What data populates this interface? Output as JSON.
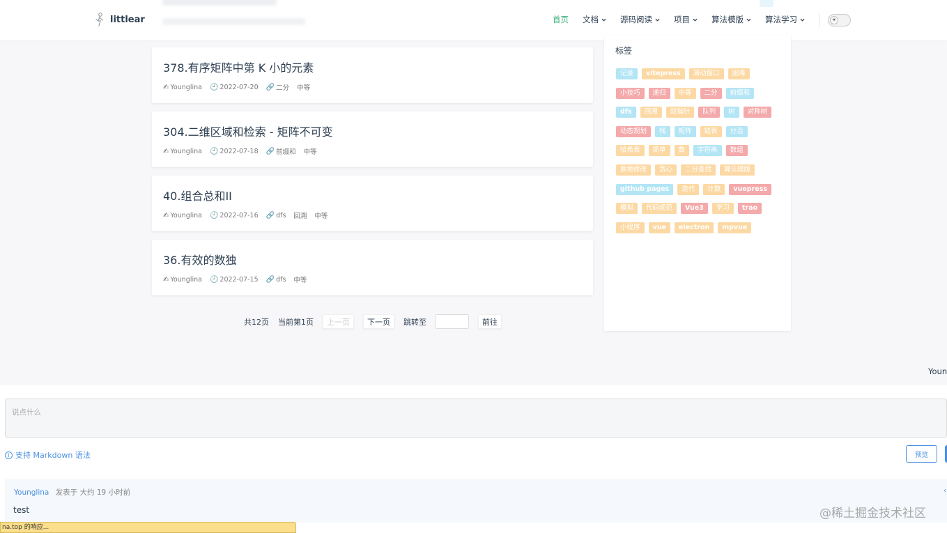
{
  "navbar": {
    "brand": "littlear",
    "items": [
      {
        "label": "首页",
        "active": true,
        "dropdown": false
      },
      {
        "label": "文档",
        "active": false,
        "dropdown": true
      },
      {
        "label": "源码阅读",
        "active": false,
        "dropdown": true
      },
      {
        "label": "项目",
        "active": false,
        "dropdown": true
      },
      {
        "label": "算法模版",
        "active": false,
        "dropdown": true
      },
      {
        "label": "算法学习",
        "active": false,
        "dropdown": true
      }
    ],
    "theme_icon": "☀"
  },
  "articles": [
    {
      "title": "378.有序矩阵中第 K 小的元素",
      "author": "Younglina",
      "date": "2022-07-20",
      "tags": [
        "二分"
      ],
      "difficulty": "中等"
    },
    {
      "title": "304.二维区域和检索 - 矩阵不可变",
      "author": "Younglina",
      "date": "2022-07-18",
      "tags": [
        "前缀和"
      ],
      "difficulty": "中等"
    },
    {
      "title": "40.组合总和II",
      "author": "Younglina",
      "date": "2022-07-16",
      "tags": [
        "dfs",
        "回溯"
      ],
      "difficulty": "中等"
    },
    {
      "title": "36.有效的数独",
      "author": "Younglina",
      "date": "2022-07-15",
      "tags": [
        "dfs"
      ],
      "difficulty": "中等"
    }
  ],
  "meta_icons": {
    "author": "✍",
    "date": "🕘",
    "tag": "🔗"
  },
  "pagination": {
    "total": "共12页",
    "current": "当前第1页",
    "prev": "上一页",
    "next": "下一页",
    "jump_label": "跳转至",
    "go": "前往"
  },
  "tags_panel": {
    "title": "标签",
    "tags": [
      {
        "label": "记录",
        "color": "blue"
      },
      {
        "label": "vitepress",
        "color": "orange",
        "bold": true
      },
      {
        "label": "滑动窗口",
        "color": "orange"
      },
      {
        "label": "困难",
        "color": "orange"
      },
      {
        "label": "小技巧",
        "color": "red"
      },
      {
        "label": "递归",
        "color": "red"
      },
      {
        "label": "中等",
        "color": "orange"
      },
      {
        "label": "二分",
        "color": "red"
      },
      {
        "label": "前缀和",
        "color": "blue"
      },
      {
        "label": "dfs",
        "color": "blue",
        "bold": true
      },
      {
        "label": "回溯",
        "color": "orange"
      },
      {
        "label": "双指针",
        "color": "orange"
      },
      {
        "label": "队列",
        "color": "red"
      },
      {
        "label": "树",
        "color": "blue"
      },
      {
        "label": "对称树",
        "color": "red"
      },
      {
        "label": "动态规划",
        "color": "red"
      },
      {
        "label": "栈",
        "color": "blue"
      },
      {
        "label": "矩阵",
        "color": "blue"
      },
      {
        "label": "链表",
        "color": "orange"
      },
      {
        "label": "分治",
        "color": "blue"
      },
      {
        "label": "哈希表",
        "color": "orange"
      },
      {
        "label": "简单",
        "color": "orange"
      },
      {
        "label": "数",
        "color": "orange"
      },
      {
        "label": "字符串",
        "color": "blue"
      },
      {
        "label": "数组",
        "color": "red"
      },
      {
        "label": "原地修改",
        "color": "orange"
      },
      {
        "label": "贪心",
        "color": "orange"
      },
      {
        "label": "二分查找",
        "color": "orange"
      },
      {
        "label": "算法模版",
        "color": "orange"
      },
      {
        "label": "github pages",
        "color": "blue",
        "bold": true
      },
      {
        "label": "迭代",
        "color": "orange"
      },
      {
        "label": "计数",
        "color": "orange"
      },
      {
        "label": "vuepress",
        "color": "red",
        "bold": true
      },
      {
        "label": "模拟",
        "color": "orange"
      },
      {
        "label": "代码规范",
        "color": "orange"
      },
      {
        "label": "Vue3",
        "color": "red",
        "bold": true
      },
      {
        "label": "学习",
        "color": "orange"
      },
      {
        "label": "trao",
        "color": "red",
        "bold": true
      },
      {
        "label": "小程序",
        "color": "orange"
      },
      {
        "label": "vue",
        "color": "orange",
        "bold": true
      },
      {
        "label": "electron",
        "color": "orange",
        "bold": true
      },
      {
        "label": "mpvue",
        "color": "orange",
        "bold": true
      }
    ]
  },
  "footer": {
    "author_partial": "Youn"
  },
  "comments": {
    "placeholder": "说点什么",
    "markdown_hint": "支持 Markdown 语法",
    "info_icon": "i",
    "preview_label": "预览",
    "items": [
      {
        "author": "Younglina",
        "action": "发表于",
        "time": "大约 19 小时前",
        "body": "test"
      }
    ]
  },
  "watermark": "@稀土掘金技术社区",
  "status_bar": "na.top 的响应..."
}
